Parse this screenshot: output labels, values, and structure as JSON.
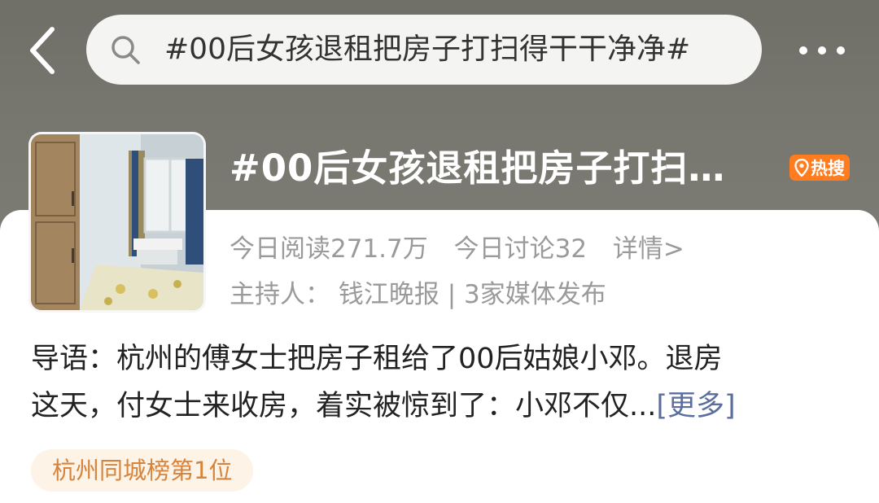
{
  "search": {
    "query": "#00后女孩退租把房子打扫得干干净净#"
  },
  "topic": {
    "title": "#00后女孩退租把房子打扫…",
    "hot_badge": "热搜",
    "read_today": "今日阅读271.7万",
    "discuss_today": "今日讨论32",
    "detail_link": "详情>",
    "host_label": "主持人：",
    "host_name": "钱江晚报",
    "separator": "|",
    "media_count": "3家媒体发布"
  },
  "intro": {
    "line1": "导语：杭州的傅女士把房子租给了00后姑娘小邓。退房",
    "line2": "这天，付女士来收房，着实被惊到了：小邓不仅...",
    "more_link": "[更多]"
  },
  "rank_tag": "杭州同城榜第1位",
  "colors": {
    "hero_bg": "#77776f",
    "hot_badge": "#ff7d1f",
    "more_link": "#5b6e9c",
    "rank_tag_text": "#d6843d",
    "rank_tag_bg": "#fdf3e6"
  },
  "icons": {
    "back": "chevron-left-icon",
    "search": "search-icon",
    "more": "more-dots-icon",
    "location": "location-pin-icon"
  }
}
